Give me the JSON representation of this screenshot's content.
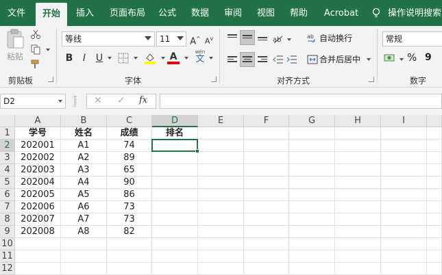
{
  "tabs": [
    "文件",
    "开始",
    "插入",
    "页面布局",
    "公式",
    "数据",
    "审阅",
    "视图",
    "帮助",
    "Acrobat"
  ],
  "active_tab": "开始",
  "tell_me": "操作说明搜索",
  "colors": {
    "brand": "#217346",
    "font_color_bar": "#e00000",
    "highlight_bar": "#ffff00"
  },
  "ribbon": {
    "clipboard": {
      "paste": "粘贴",
      "label": "剪贴板"
    },
    "font": {
      "name": "等线",
      "size": "11",
      "grow": "A",
      "shrink": "A",
      "bold": "B",
      "italic": "I",
      "underline": "U",
      "font_color": "A",
      "phonetic": "wén",
      "phonetic_char": "文",
      "label": "字体"
    },
    "alignment": {
      "wrap": "自动换行",
      "merge": "合并后居中",
      "label": "对齐方式"
    },
    "number": {
      "format": "常规",
      "percent": "%",
      "comma": "9",
      "label": "数字"
    }
  },
  "formula_bar": {
    "name_box": "D2",
    "cancel": "✕",
    "enter": "✓",
    "fx": "fx",
    "content": ""
  },
  "columns": [
    "A",
    "B",
    "C",
    "D",
    "E",
    "F",
    "G",
    "H",
    "I"
  ],
  "selected_column": "D",
  "rows": [
    "1",
    "2",
    "3",
    "4",
    "5",
    "6",
    "7",
    "8",
    "9",
    "10",
    "11",
    "12"
  ],
  "selected_row": "2",
  "headers": [
    "学号",
    "姓名",
    "成绩",
    "排名"
  ],
  "data": [
    [
      "202001",
      "A1",
      "74"
    ],
    [
      "202002",
      "A2",
      "89"
    ],
    [
      "202003",
      "A3",
      "65"
    ],
    [
      "202004",
      "A4",
      "90"
    ],
    [
      "202005",
      "A5",
      "86"
    ],
    [
      "202006",
      "A6",
      "73"
    ],
    [
      "202007",
      "A7",
      "73"
    ],
    [
      "202008",
      "A8",
      "82"
    ]
  ]
}
